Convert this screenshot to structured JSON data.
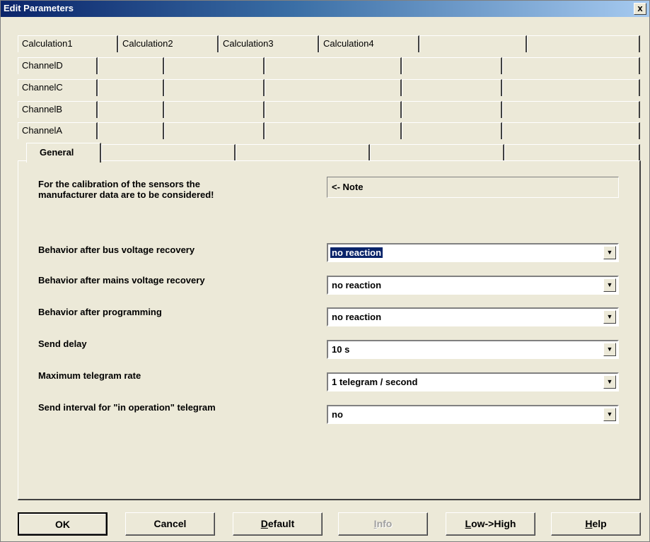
{
  "window": {
    "title": "Edit Parameters",
    "close_label": "x"
  },
  "tabs": {
    "calculation_row": [
      "Calculation1",
      "Calculation2",
      "Calculation3",
      "Calculation4",
      "",
      ""
    ],
    "channel_d_row": [
      "ChannelD",
      "",
      "",
      "",
      "",
      ""
    ],
    "channel_c_row": [
      "ChannelC",
      "",
      "",
      "",
      "",
      ""
    ],
    "channel_b_row": [
      "ChannelB",
      "",
      "",
      "",
      "",
      ""
    ],
    "channel_a_row": [
      "ChannelA",
      "",
      "",
      "",
      "",
      ""
    ],
    "general_row": [
      "General",
      "",
      "",
      "",
      ""
    ]
  },
  "note": {
    "text_line1": "For the calibration of the sensors the",
    "text_line2": "manufacturer data are to be considered!",
    "box_label": "<- Note"
  },
  "parameters": [
    {
      "label": "Behavior after bus voltage recovery",
      "value": "no reaction"
    },
    {
      "label": "Behavior after mains voltage recovery",
      "value": "no reaction"
    },
    {
      "label": "Behavior after programming",
      "value": "no reaction"
    },
    {
      "label": "Send delay",
      "value": "10 s"
    },
    {
      "label": "Maximum telegram rate",
      "value": "1 telegram / second"
    },
    {
      "label": "Send interval for \"in operation\" telegram",
      "value": "no"
    }
  ],
  "buttons": {
    "ok": "OK",
    "cancel": "Cancel",
    "default_pre": "",
    "default_key": "D",
    "default_post": "efault",
    "info_pre": "",
    "info_key": "I",
    "info_post": "nfo",
    "lowhigh_pre": "",
    "lowhigh_key": "L",
    "lowhigh_post": "ow->High",
    "help_pre": "",
    "help_key": "H",
    "help_post": "elp"
  },
  "colors": {
    "dialog_bg": "#ece9d8",
    "title_start": "#0a246a",
    "selection": "#0a246a"
  },
  "icons": {
    "close": "close-icon",
    "dropdown": "chevron-down-icon"
  }
}
